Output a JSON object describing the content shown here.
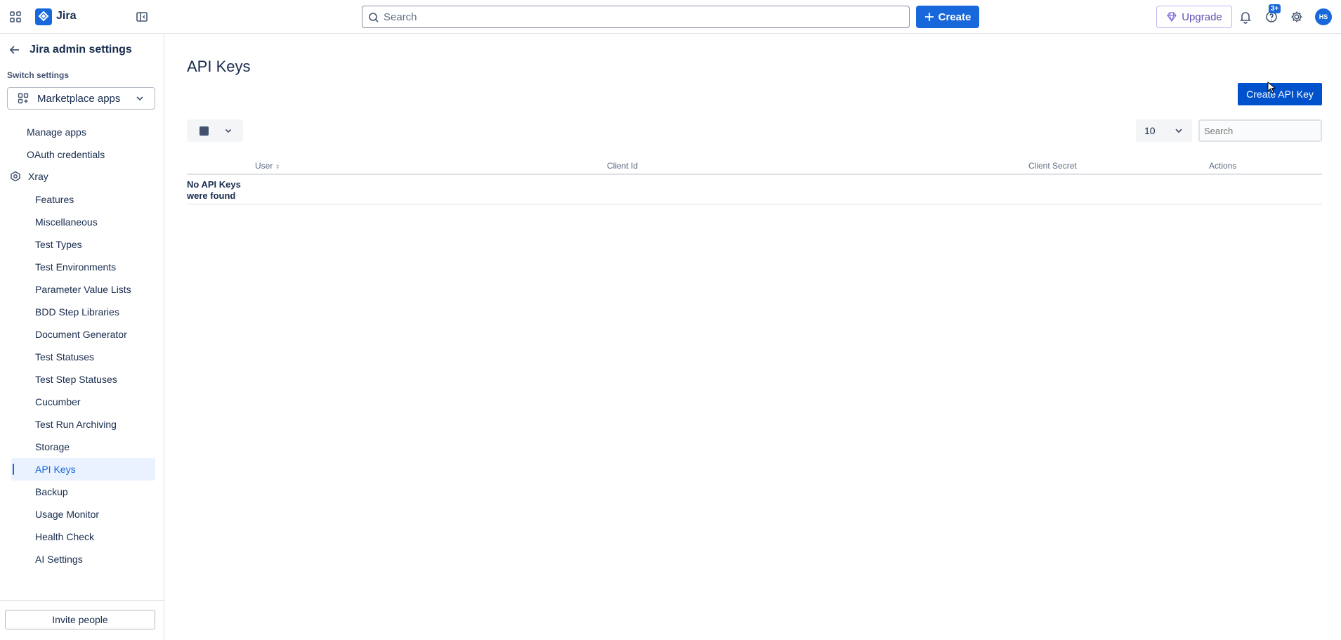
{
  "topbar": {
    "app_name": "Jira",
    "search_placeholder": "Search",
    "create_label": "Create",
    "upgrade_label": "Upgrade",
    "help_badge": "3+",
    "avatar_initials": "HS",
    "brand_color": "#1868db"
  },
  "sidebar": {
    "back_title": "Jira admin settings",
    "switch_label": "Switch settings",
    "switch_value": "Marketplace apps",
    "top_items": [
      "Manage apps",
      "OAuth credentials"
    ],
    "group_label": "Xray",
    "group_items": [
      "Features",
      "Miscellaneous",
      "Test Types",
      "Test Environments",
      "Parameter Value Lists",
      "BDD Step Libraries",
      "Document Generator",
      "Test Statuses",
      "Test Step Statuses",
      "Cucumber",
      "Test Run Archiving",
      "Storage",
      "API Keys",
      "Backup",
      "Usage Monitor",
      "Health Check",
      "AI Settings"
    ],
    "active_item": "API Keys",
    "invite_label": "Invite people"
  },
  "main": {
    "title": "API Keys",
    "create_key_label": "Create API Key",
    "page_size": "10",
    "search_placeholder": "Search",
    "columns": [
      "User",
      "Client Id",
      "Client Secret",
      "Actions"
    ],
    "empty_message": "No API Keys were found"
  }
}
